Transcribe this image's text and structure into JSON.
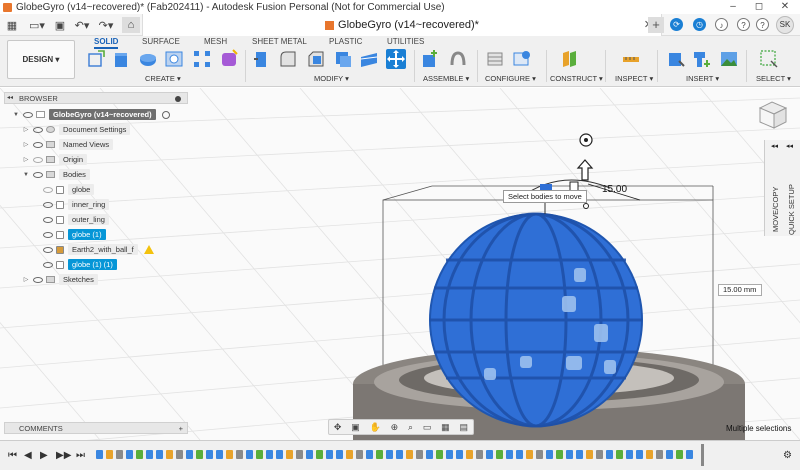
{
  "window": {
    "title": "GlobeGyro (v14~recovered)* (Fab202411) - Autodesk Fusion Personal (Not for Commercial Use)",
    "controls": [
      "–",
      "◻",
      "✕"
    ]
  },
  "tabbar": {
    "doc_tab": "GlobeGyro (v14~recovered)*",
    "close": "✕",
    "plus": "+",
    "badge_count": "",
    "avatar": "SK"
  },
  "ribbon": {
    "workspace": "DESIGN ▾",
    "tabs": [
      "SOLID",
      "SURFACE",
      "MESH",
      "SHEET METAL",
      "PLASTIC",
      "UTILITIES"
    ],
    "active_tab": "SOLID",
    "groups": [
      "CREATE ▾",
      "MODIFY ▾",
      "ASSEMBLE ▾",
      "CONFIGURE ▾",
      "CONSTRUCT ▾",
      "INSPECT ▾",
      "INSERT ▾",
      "SELECT ▾"
    ]
  },
  "browser": {
    "title": "BROWSER",
    "items": [
      {
        "label": "GlobeGyro (v14~recovered)",
        "style": "dark",
        "indent": 0,
        "kind": "root"
      },
      {
        "label": "Document Settings",
        "style": "",
        "indent": 1,
        "kind": "settings"
      },
      {
        "label": "Named Views",
        "style": "",
        "indent": 1,
        "kind": "folder"
      },
      {
        "label": "Origin",
        "style": "",
        "indent": 1,
        "kind": "folder"
      },
      {
        "label": "Bodies",
        "style": "",
        "indent": 1,
        "kind": "folder"
      },
      {
        "label": "globe",
        "style": "",
        "indent": 2,
        "kind": "body"
      },
      {
        "label": "inner_ring",
        "style": "",
        "indent": 2,
        "kind": "body"
      },
      {
        "label": "outer_ling",
        "style": "",
        "indent": 2,
        "kind": "body"
      },
      {
        "label": "globe (1)",
        "style": "sel",
        "indent": 2,
        "kind": "body"
      },
      {
        "label": "Earth2_with_ball_f",
        "style": "",
        "indent": 2,
        "kind": "mesh"
      },
      {
        "label": "globe (1) (1)",
        "style": "sel",
        "indent": 2,
        "kind": "body"
      },
      {
        "label": "Sketches",
        "style": "",
        "indent": 1,
        "kind": "folder"
      }
    ]
  },
  "viewport": {
    "tooltip": "Select bodies to move",
    "dimension_label": "15.00",
    "dimension_input": "15.00 mm",
    "side_panel_1": "MOVE/COPY",
    "side_panel_2": "QUICK SETUP",
    "status": "Multiple selections"
  },
  "comments": {
    "title": "COMMENTS",
    "plus": "+"
  },
  "colors": {
    "accent": "#1a63b8",
    "selection": "#0696d7",
    "model_blue": "#2f6fd6",
    "base_gray": "#8a8580"
  }
}
